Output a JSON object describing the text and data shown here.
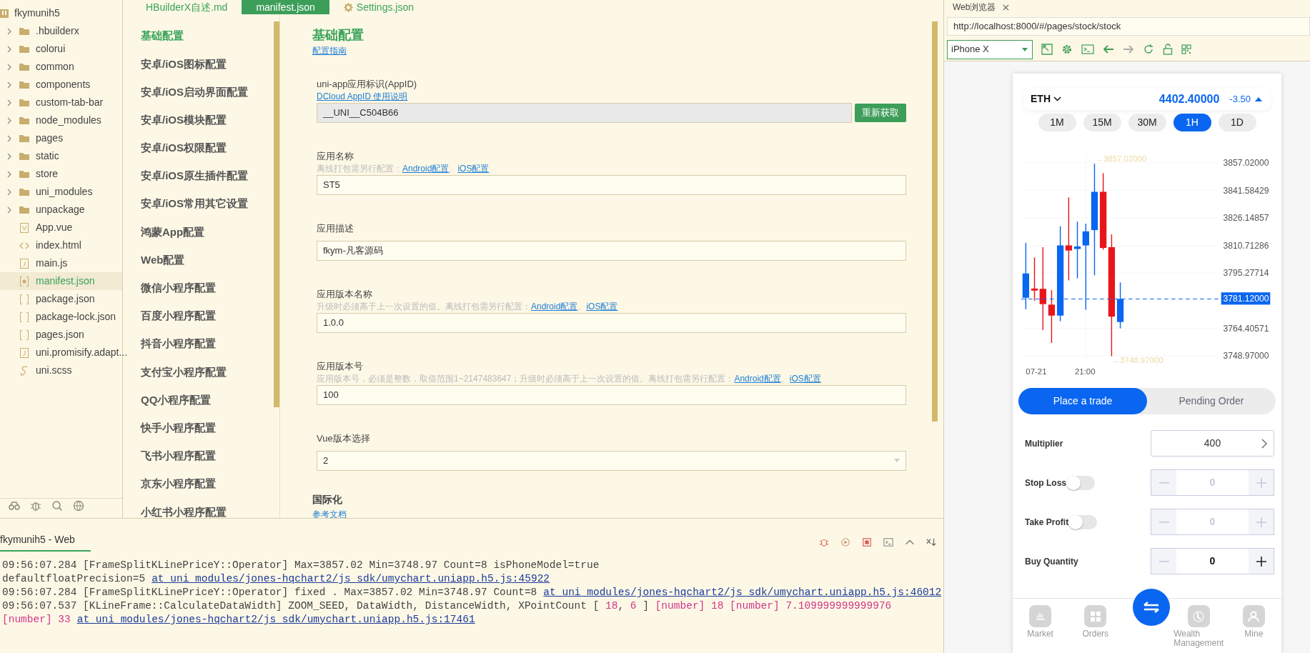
{
  "file_tree": {
    "name": "fkymunih5",
    "expanded": true,
    "children": [
      {
        "name": ".hbuilderx",
        "kind": "folder",
        "expanded": false,
        "selected": false
      },
      {
        "name": "colorui",
        "kind": "folder",
        "expanded": false,
        "selected": false
      },
      {
        "name": "common",
        "kind": "folder",
        "expanded": false,
        "selected": false
      },
      {
        "name": "components",
        "kind": "folder",
        "expanded": false,
        "selected": false
      },
      {
        "name": "custom-tab-bar",
        "kind": "folder",
        "expanded": false,
        "selected": false
      },
      {
        "name": "node_modules",
        "kind": "folder",
        "expanded": false,
        "selected": false
      },
      {
        "name": "pages",
        "kind": "folder",
        "expanded": false,
        "selected": false
      },
      {
        "name": "static",
        "kind": "folder",
        "expanded": false,
        "selected": false
      },
      {
        "name": "store",
        "kind": "folder",
        "expanded": false,
        "selected": false
      },
      {
        "name": "uni_modules",
        "kind": "folder",
        "expanded": false,
        "selected": false
      },
      {
        "name": "unpackage",
        "kind": "folder",
        "expanded": false,
        "selected": false
      },
      {
        "name": "App.vue",
        "kind": "vue",
        "selected": false
      },
      {
        "name": "index.html",
        "kind": "html",
        "selected": false
      },
      {
        "name": "main.js",
        "kind": "js",
        "selected": false
      },
      {
        "name": "manifest.json",
        "kind": "config",
        "selected": true
      },
      {
        "name": "package.json",
        "kind": "json",
        "selected": false
      },
      {
        "name": "package-lock.json",
        "kind": "json",
        "selected": false
      },
      {
        "name": "pages.json",
        "kind": "json",
        "selected": false
      },
      {
        "name": "uni.promisify.adapt...",
        "kind": "js",
        "selected": false
      },
      {
        "name": "uni.scss",
        "kind": "scss",
        "selected": false
      }
    ]
  },
  "editor_tabs": [
    {
      "label": "HBuilderX自述.md",
      "kind": "file",
      "selected": false
    },
    {
      "label": "manifest.json",
      "kind": "file",
      "selected": true
    },
    {
      "label": "Settings.json",
      "kind": "settings",
      "selected": false
    }
  ],
  "settings_nav": [
    {
      "label": "基础配置",
      "selected": true
    },
    {
      "label": "安卓/iOS图标配置",
      "selected": false
    },
    {
      "label": "安卓/iOS启动界面配置",
      "selected": false
    },
    {
      "label": "安卓/iOS模块配置",
      "selected": false
    },
    {
      "label": "安卓/iOS权限配置",
      "selected": false
    },
    {
      "label": "安卓/iOS原生插件配置",
      "selected": false
    },
    {
      "label": "安卓/iOS常用其它设置",
      "selected": false
    },
    {
      "label": "鸿蒙App配置",
      "selected": false
    },
    {
      "label": "Web配置",
      "selected": false
    },
    {
      "label": "微信小程序配置",
      "selected": false
    },
    {
      "label": "百度小程序配置",
      "selected": false
    },
    {
      "label": "抖音小程序配置",
      "selected": false
    },
    {
      "label": "支付宝小程序配置",
      "selected": false
    },
    {
      "label": "QQ小程序配置",
      "selected": false
    },
    {
      "label": "快手小程序配置",
      "selected": false
    },
    {
      "label": "飞书小程序配置",
      "selected": false
    },
    {
      "label": "京东小程序配置",
      "selected": false
    },
    {
      "label": "小红书小程序配置",
      "selected": false
    }
  ],
  "form": {
    "title": "基础配置",
    "guide_link": "配置指南",
    "fields": [
      {
        "kind": "input-button",
        "label": "uni-app应用标识(AppID)",
        "hint_parts": [
          {
            "kind": "link",
            "text": "DCloud AppID 使用说明"
          }
        ],
        "value": "__UNI__C504B66",
        "readonly": true,
        "button": "重新获取"
      },
      {
        "kind": "input",
        "label": "应用名称",
        "hint_parts": [
          {
            "kind": "text",
            "text": "离线打包需另行配置："
          },
          {
            "kind": "link",
            "text": "Android配置"
          },
          {
            "kind": "text",
            "text": "、"
          },
          {
            "kind": "link",
            "text": "iOS配置"
          }
        ],
        "value": "ST5"
      },
      {
        "kind": "input",
        "label": "应用描述",
        "value": "fkym-凡客源码"
      },
      {
        "kind": "input",
        "label": "应用版本名称",
        "hint_parts": [
          {
            "kind": "text",
            "text": "升级时必须高于上一次设置的值。离线打包需另行配置："
          },
          {
            "kind": "link",
            "text": "Android配置"
          },
          {
            "kind": "text",
            "text": "、"
          },
          {
            "kind": "link",
            "text": "iOS配置"
          }
        ],
        "value": "1.0.0"
      },
      {
        "kind": "input",
        "label": "应用版本号",
        "hint_parts": [
          {
            "kind": "text",
            "text": "应用版本号，必须是整数，取值范围1~2147483647；升级时必须高于上一次设置的值。离线打包需另行配置："
          },
          {
            "kind": "link",
            "text": "Android配置"
          },
          {
            "kind": "text",
            "text": "、"
          },
          {
            "kind": "link",
            "text": "iOS配置"
          }
        ],
        "value": "100"
      },
      {
        "kind": "select",
        "label": "Vue版本选择",
        "value": "2"
      }
    ],
    "section": {
      "title": "国际化",
      "link": "参考文档"
    }
  },
  "console": {
    "title": "fkymunih5 - Web",
    "lines": [
      {
        "segments": [
          {
            "kind": "text",
            "text": "09:56:07.284 [FrameSplitKLinePriceY::Operator] Max=3857.02 Min=3748.97 Count=8 isPhoneModel=true defaultfloatPrecision=5"
          },
          {
            "kind": "link",
            "text": "at_uni_modules/jones-hqchart2/js_sdk/umychart.uniapp.h5.js:45922"
          }
        ]
      },
      {
        "segments": [
          {
            "kind": "text",
            "text": "09:56:07.284 [FrameSplitKLinePriceY::Operator] fixed . Max=3857.02 Min=3748.97 Count=8"
          },
          {
            "kind": "link",
            "text": "at_uni_modules/jones-hqchart2/js_sdk/umychart.uniapp.h5.js:46012"
          }
        ]
      },
      {
        "segments": [
          {
            "kind": "text",
            "text": "09:56:07.537 [KLineFrame::CalculateDataWidth] ZOOM_SEED, DataWidth, DistanceWidth, XPointCount [ "
          },
          {
            "kind": "number",
            "text": "18"
          },
          {
            "kind": "text",
            "text": ", "
          },
          {
            "kind": "number",
            "text": "6"
          },
          {
            "kind": "text",
            "text": " ] "
          },
          {
            "kind": "number",
            "text": "[number] 18 [number] 7.109999999999976 [number] 33"
          },
          {
            "kind": "link",
            "text": "at_uni_modules/jones-hqchart2/js_sdk/umychart.uniapp.h5.js:17461"
          }
        ]
      }
    ]
  },
  "browser": {
    "tab": "Web浏览器",
    "url": "http://localhost:8000/#/pages/stock/stock",
    "device": "iPhone X",
    "back_disabled": false,
    "forward_disabled": true
  },
  "phone": {
    "symbol": "ETH",
    "price": "4402.40000",
    "change": "-3.50",
    "periods": [
      {
        "label": "1M",
        "selected": false
      },
      {
        "label": "15M",
        "selected": false
      },
      {
        "label": "30M",
        "selected": false
      },
      {
        "label": "1H",
        "selected": true
      },
      {
        "label": "1D",
        "selected": false
      }
    ],
    "chart": {
      "y_labels": [
        "3857.02000",
        "3841.58429",
        "3826.14857",
        "3810.71286",
        "3795.27714",
        "3764.40571",
        "3748.97000"
      ],
      "current_price": "3781.12000",
      "x_labels": [
        "07-21",
        "21:00"
      ],
      "high_marker": "←3857.02000",
      "low_marker": "←3748.97000"
    },
    "trade_tabs": [
      {
        "label": "Place a trade",
        "selected": true
      },
      {
        "label": "Pending Order",
        "selected": false
      }
    ],
    "rows": [
      {
        "kind": "select",
        "label": "Multiplier",
        "value": "400"
      },
      {
        "kind": "toggle-stepper",
        "label": "Stop Loss",
        "on": false,
        "value": "0"
      },
      {
        "kind": "toggle-stepper",
        "label": "Take Profit",
        "on": false,
        "value": "0"
      },
      {
        "kind": "stepper",
        "label": "Buy Quantity",
        "value": "0"
      }
    ],
    "nav": [
      {
        "label": "Market",
        "kind": "chart"
      },
      {
        "label": "Orders",
        "kind": "grid"
      },
      {
        "label": "Wealth Management",
        "kind": "clock"
      },
      {
        "label": "Mine",
        "kind": "person"
      }
    ]
  }
}
